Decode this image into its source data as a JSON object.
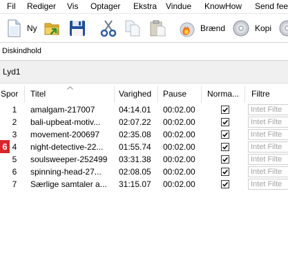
{
  "menu": {
    "items": [
      "Fil",
      "Rediger",
      "Vis",
      "Optager",
      "Ekstra",
      "Vindue",
      "KnowHow",
      "Send fee"
    ]
  },
  "toolbar": {
    "new_label": "Ny",
    "burn_label": "Brænd",
    "copy_label": "Kopi",
    "icons": [
      "new-document-icon",
      "open-folder-icon",
      "save-icon",
      "scissors-icon",
      "copy-icon",
      "paste-icon",
      "burn-disc-icon",
      "copy-disc-icon",
      "disc-icon"
    ]
  },
  "panel": {
    "title": "Diskindhold"
  },
  "compilation": {
    "name": "Lyd1"
  },
  "table": {
    "columns": [
      {
        "label": "Spor"
      },
      {
        "label": "Titel",
        "sort_icon": "sort-ascending-icon"
      },
      {
        "label": "Varighed"
      },
      {
        "label": "Pause"
      },
      {
        "label": "Norma..."
      },
      {
        "label": "Filtre"
      }
    ],
    "rows": [
      {
        "track": "1",
        "title": "amalgam-217007",
        "duration": "04:14.01",
        "pause": "00:02.00",
        "normalize": true,
        "filter": "Intet Filte"
      },
      {
        "track": "2",
        "title": "bali-upbeat-motiv...",
        "duration": "02:07.22",
        "pause": "00:02.00",
        "normalize": true,
        "filter": "Intet Filte"
      },
      {
        "track": "3",
        "title": "movement-200697",
        "duration": "02:35.08",
        "pause": "00:02.00",
        "normalize": true,
        "filter": "Intet Filte"
      },
      {
        "track": "4",
        "title": "night-detective-22...",
        "duration": "01:55.74",
        "pause": "00:02.00",
        "normalize": true,
        "filter": "Intet Filte"
      },
      {
        "track": "5",
        "title": "soulsweeper-252499",
        "duration": "03:31.38",
        "pause": "00:02.00",
        "normalize": true,
        "filter": "Intet Filte"
      },
      {
        "track": "6",
        "title": "spinning-head-27...",
        "duration": "02:08.05",
        "pause": "00:02.00",
        "normalize": true,
        "filter": "Intet Filte"
      },
      {
        "track": "7",
        "title": "Særlige samtaler a...",
        "duration": "31:15.07",
        "pause": "00:02.00",
        "normalize": true,
        "filter": "Intet Filte"
      }
    ]
  },
  "badge": {
    "label": "6"
  },
  "colors": {
    "badge": "#d9262b",
    "band_background": "#f0f0f0",
    "filter_placeholder": "#a3a3a3"
  }
}
